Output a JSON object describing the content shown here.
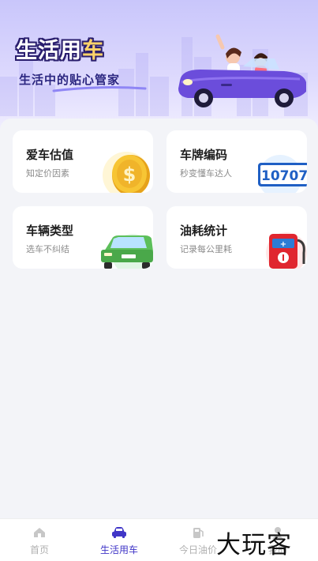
{
  "banner": {
    "title_main": "生活用",
    "title_accent": "车",
    "subtitle": "生活中的贴心管家"
  },
  "cards": [
    {
      "title": "爱车估值",
      "desc": "知定价因素",
      "icon": "gold-coin-icon"
    },
    {
      "title": "车牌编码",
      "desc": "秒变懂车达人",
      "icon": "license-plate-icon",
      "plate_text": "10707"
    },
    {
      "title": "车辆类型",
      "desc": "选车不纠结",
      "icon": "green-car-icon"
    },
    {
      "title": "油耗统计",
      "desc": "记录每公里耗",
      "icon": "fuel-pump-icon"
    }
  ],
  "nav": {
    "items": [
      {
        "label": "首页",
        "icon": "home-icon",
        "active": false
      },
      {
        "label": "生活用车",
        "icon": "car-icon",
        "active": true
      },
      {
        "label": "今日油价",
        "icon": "fuel-price-icon",
        "active": false
      },
      {
        "label": "我的",
        "icon": "profile-icon",
        "active": false
      }
    ]
  },
  "watermark": "大玩客",
  "colors": {
    "accent": "#4036c7",
    "banner_bg": "#d9d5fd",
    "inactive": "#b0b0b0"
  }
}
